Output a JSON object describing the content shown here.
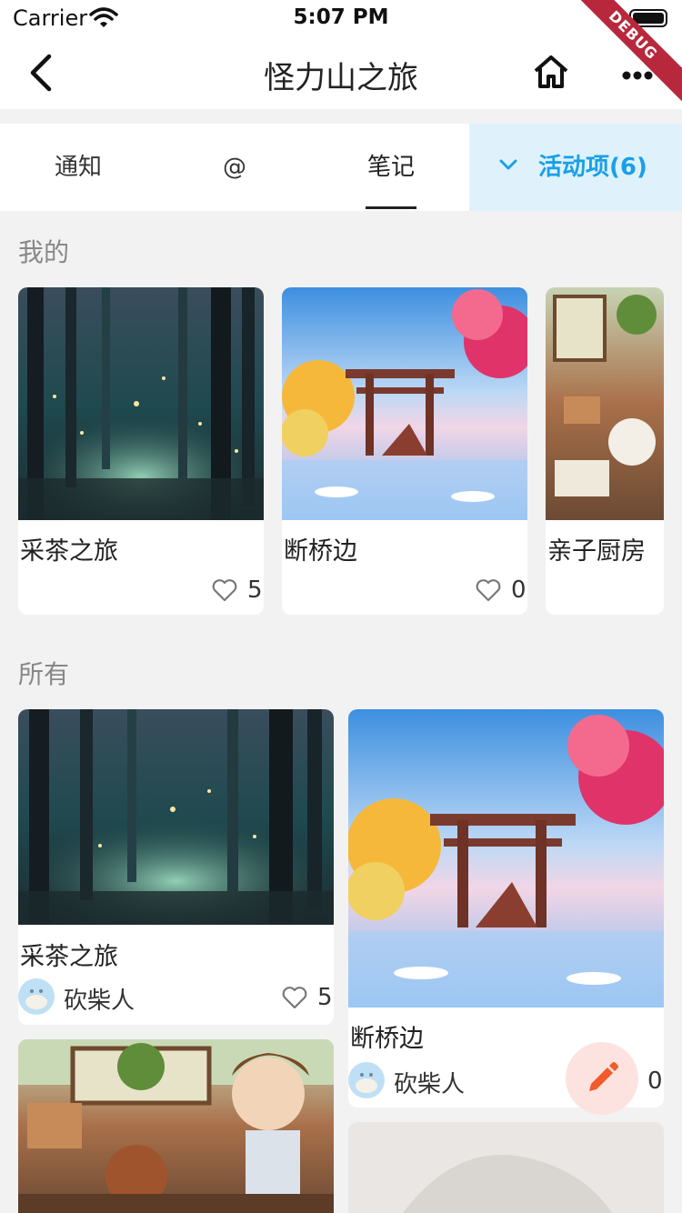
{
  "status": {
    "carrier": "Carrier",
    "time": "5:07 PM"
  },
  "debug_banner": "DEBUG",
  "nav": {
    "title": "怪力山之旅",
    "icons": [
      "back-icon",
      "home-icon",
      "more-icon"
    ]
  },
  "tabs": {
    "items": [
      {
        "label": "通知"
      },
      {
        "label": "@"
      },
      {
        "label": "笔记"
      }
    ],
    "active_index": 2,
    "activity": {
      "label": "活动项(6)"
    }
  },
  "colors": {
    "accent": "#1aa0e6",
    "activity_bg": "#dff2fc",
    "fab_bg": "#fde3df",
    "fab_icon": "#f15a2b"
  },
  "mine": {
    "title": "我的",
    "cards": [
      {
        "title": "采茶之旅",
        "likes": "5"
      },
      {
        "title": "断桥边",
        "likes": "0"
      },
      {
        "title": "亲子厨房",
        "likes": ""
      }
    ]
  },
  "all": {
    "title": "所有",
    "cards": [
      {
        "title": "采茶之旅",
        "author": "砍柴人",
        "likes": "5"
      },
      {
        "title": "断桥边",
        "author": "砍柴人",
        "likes": "0"
      }
    ]
  }
}
